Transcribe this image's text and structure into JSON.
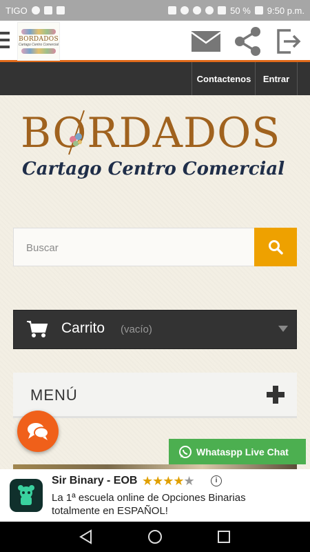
{
  "status_bar": {
    "carrier": "TIGO",
    "battery": "50 %",
    "time": "9:50 p.m."
  },
  "app_bar": {
    "logo_text": "BORDADOS",
    "logo_sub": "Cartago Centro Comercial"
  },
  "nav": {
    "contact": "Contactenos",
    "login": "Entrar"
  },
  "brand": {
    "title": "BORDADOS",
    "subtitle": "Cartago Centro Comercial"
  },
  "search": {
    "placeholder": "Buscar"
  },
  "cart": {
    "label": "Carrito",
    "status": "(vacío)"
  },
  "menu": {
    "label": "MENÚ"
  },
  "whatsapp": {
    "label": "Whataspp Live Chat"
  },
  "ad": {
    "title": "Sir Binary - EOB",
    "stars": "★★★★",
    "star_empty": "★",
    "rating": 4.5,
    "info": "i",
    "description": "La 1ª escuela online de Opciones Binarias totalmente en ESPAÑOL!"
  },
  "colors": {
    "accent_orange": "#e06a1a",
    "search_button": "#eea100",
    "dark_bar": "#333333",
    "whatsapp_green": "#4caf50"
  },
  "icons": [
    "menu-icon",
    "mail-icon",
    "share-icon",
    "logout-icon",
    "search-icon",
    "cart-icon",
    "plus-icon",
    "chat-icon",
    "whatsapp-icon",
    "back-icon",
    "home-icon",
    "recents-icon"
  ]
}
